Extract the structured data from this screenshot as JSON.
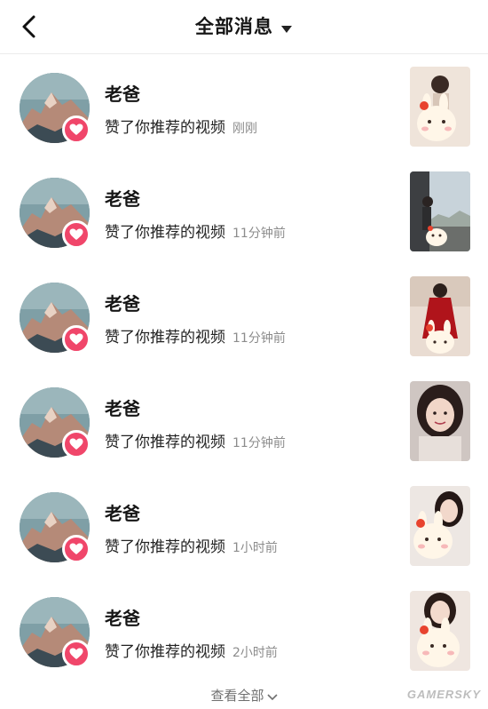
{
  "header": {
    "title": "全部消息",
    "back_icon": "chevron-left-icon",
    "dropdown_icon": "caret-down-icon"
  },
  "notifications": [
    {
      "name": "老爸",
      "action": "赞了你推荐的视频",
      "time": "刚刚",
      "thumb": "bunny-sticker-girl"
    },
    {
      "name": "老爸",
      "action": "赞了你推荐的视频",
      "time": "11分钟前",
      "thumb": "girl-window-city"
    },
    {
      "name": "老爸",
      "action": "赞了你推荐的视频",
      "time": "11分钟前",
      "thumb": "girl-red-dress"
    },
    {
      "name": "老爸",
      "action": "赞了你推荐的视频",
      "time": "11分钟前",
      "thumb": "girl-selfie"
    },
    {
      "name": "老爸",
      "action": "赞了你推荐的视频",
      "time": "1小时前",
      "thumb": "girl-bunny-sticker"
    },
    {
      "name": "老爸",
      "action": "赞了你推荐的视频",
      "time": "2小时前",
      "thumb": "girl-bunny-sticker-2"
    }
  ],
  "footer": {
    "label": "查看全部"
  },
  "watermark": "GAMERSKY",
  "colors": {
    "like_badge": "#f0466a",
    "time_text": "#8c8c8c",
    "divider": "#ececec"
  }
}
